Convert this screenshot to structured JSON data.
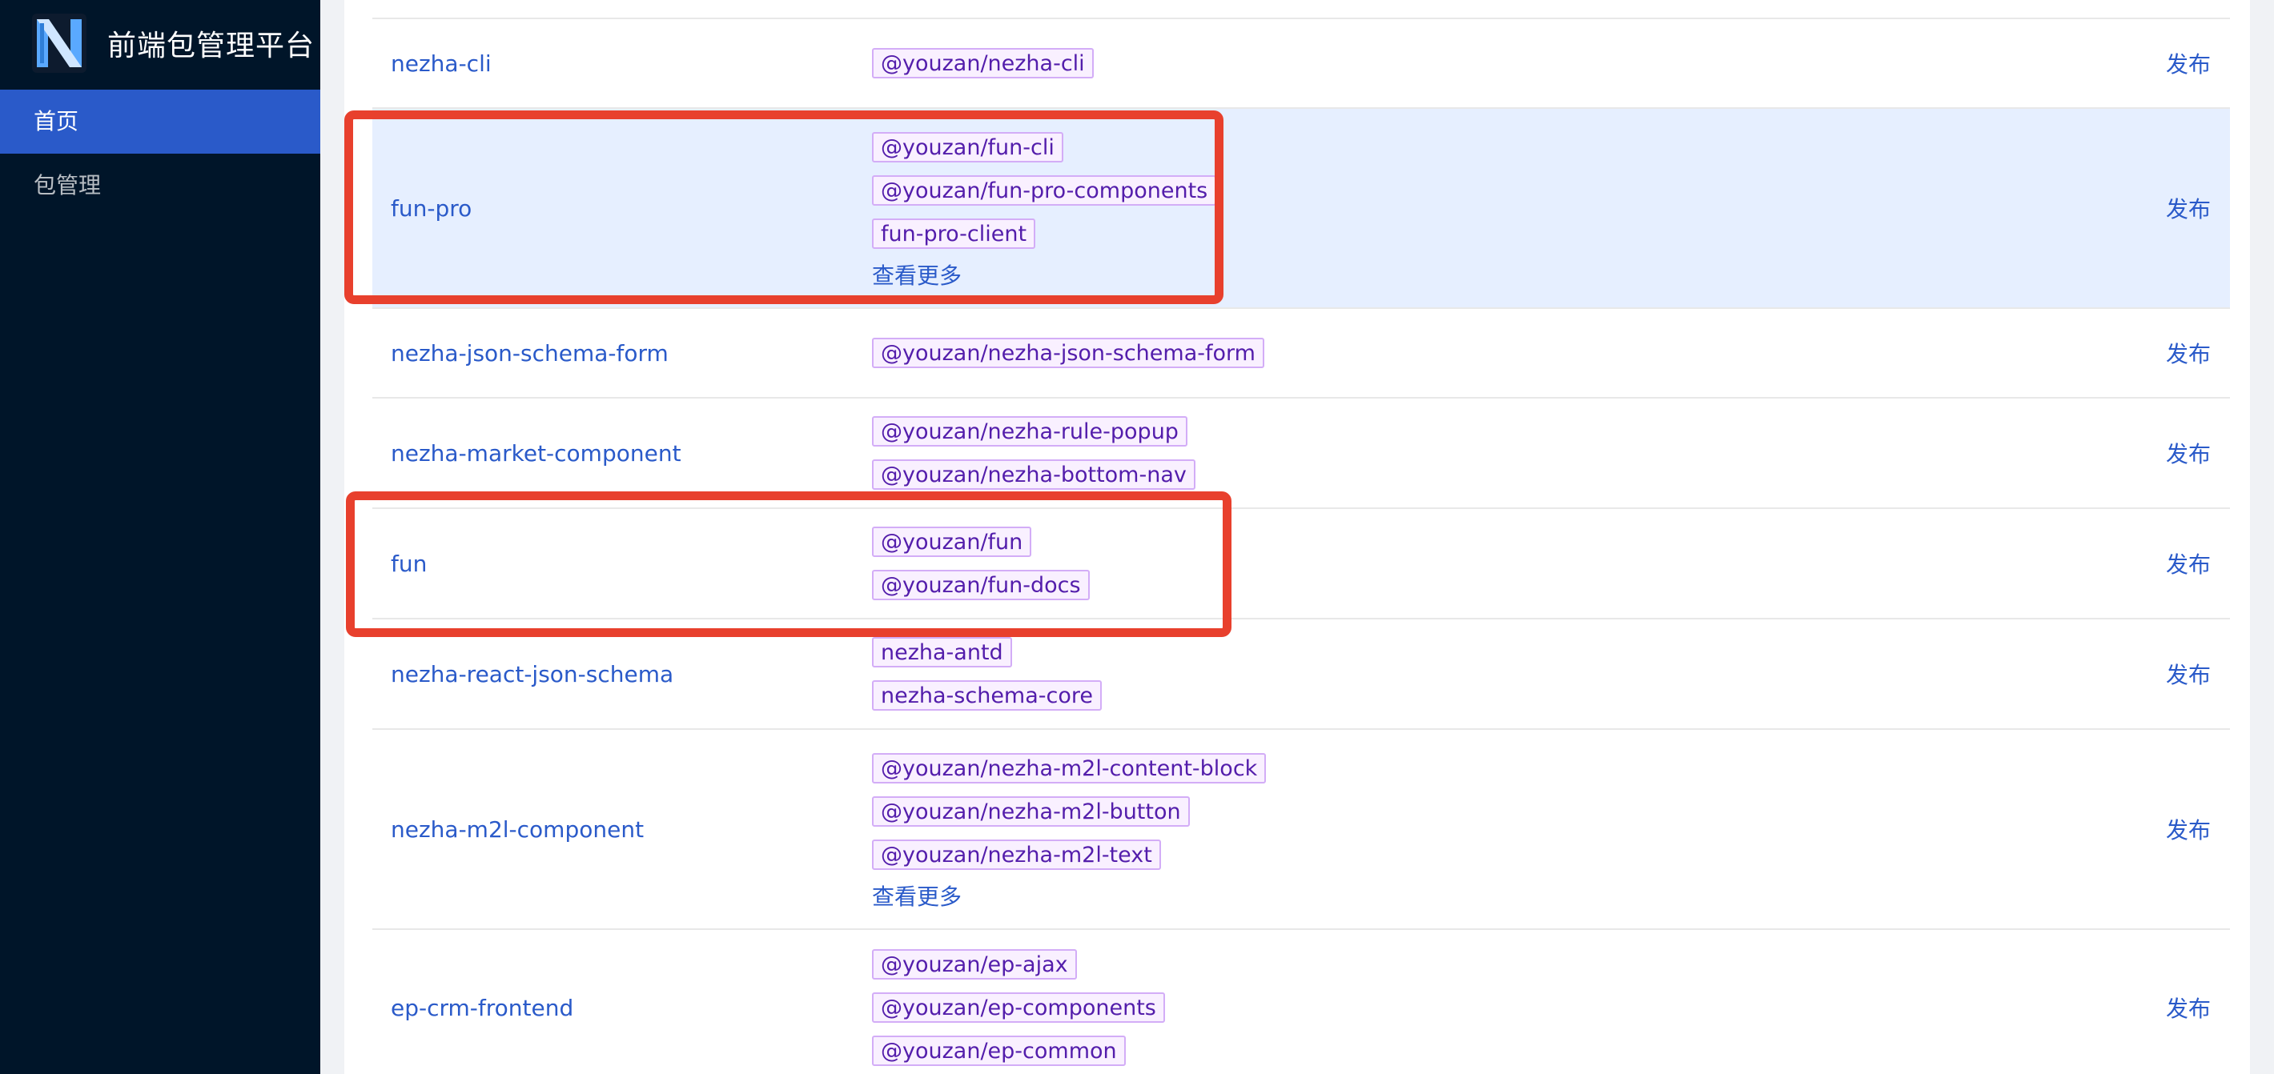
{
  "app": {
    "title": "前端包管理平台",
    "logo_icon": "n-logo-icon",
    "brand_color": "#2a5ac9",
    "sidebar_bg": "#001529"
  },
  "menu": {
    "items": [
      {
        "label": "首页",
        "active": true
      },
      {
        "label": "包管理",
        "active": false
      }
    ]
  },
  "table": {
    "rows": [
      {
        "name": "nezha-cli",
        "tags": [
          "@youzan/nezha-cli"
        ],
        "more": "",
        "action": "发布"
      },
      {
        "name": "fun-pro",
        "tags": [
          "@youzan/fun-cli",
          "@youzan/fun-pro-components",
          "fun-pro-client"
        ],
        "more": "查看更多",
        "action": "发布",
        "highlighted": true
      },
      {
        "name": "nezha-json-schema-form",
        "tags": [
          "@youzan/nezha-json-schema-form"
        ],
        "more": "",
        "action": "发布"
      },
      {
        "name": "nezha-market-component",
        "tags": [
          "@youzan/nezha-rule-popup",
          "@youzan/nezha-bottom-nav"
        ],
        "more": "",
        "action": "发布"
      },
      {
        "name": "fun",
        "tags": [
          "@youzan/fun",
          "@youzan/fun-docs"
        ],
        "more": "",
        "action": "发布"
      },
      {
        "name": "nezha-react-json-schema",
        "tags": [
          "nezha-antd",
          "nezha-schema-core"
        ],
        "more": "",
        "action": "发布"
      },
      {
        "name": "nezha-m2l-component",
        "tags": [
          "@youzan/nezha-m2l-content-block",
          "@youzan/nezha-m2l-button",
          "@youzan/nezha-m2l-text"
        ],
        "more": "查看更多",
        "action": "发布"
      },
      {
        "name": "ep-crm-frontend",
        "tags": [
          "@youzan/ep-ajax",
          "@youzan/ep-components",
          "@youzan/ep-common"
        ],
        "more": "",
        "action": "发布"
      }
    ]
  },
  "colors": {
    "link": "#2a5ac9",
    "tag_bg": "#f9f0ff",
    "tag_border": "#d3adf7",
    "tag_text": "#531dab",
    "highlight_row": "#e6efff",
    "annotation": "#e8402d"
  }
}
